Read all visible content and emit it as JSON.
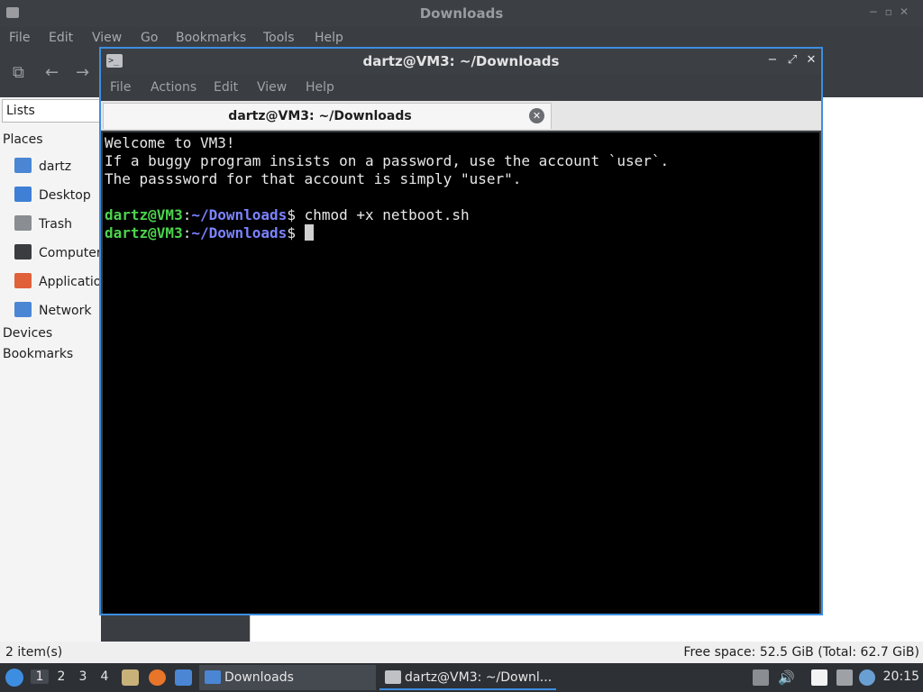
{
  "file_manager": {
    "title": "Downloads",
    "menu": [
      "File",
      "Edit",
      "View",
      "Go",
      "Bookmarks",
      "Tools",
      "Help"
    ],
    "side_mode": "Lists",
    "places_header": "Places",
    "places": [
      {
        "label": "dartz",
        "icon": "home-folder-icon",
        "color": "#4a86d4"
      },
      {
        "label": "Desktop",
        "icon": "desktop-icon",
        "color": "#3f7fd6"
      },
      {
        "label": "Trash",
        "icon": "trash-icon",
        "color": "#8a8d91"
      },
      {
        "label": "Computer",
        "icon": "computer-icon",
        "color": "#3a3c40"
      },
      {
        "label": "Applications",
        "icon": "applications-icon",
        "color": "#e0603a"
      },
      {
        "label": "Network",
        "icon": "network-icon",
        "color": "#4a86d4"
      }
    ],
    "devices_header": "Devices",
    "bookmarks_header": "Bookmarks",
    "status_left": "2 item(s)",
    "status_right": "Free space: 52.5 GiB (Total: 62.7 GiB)"
  },
  "terminal": {
    "title": "dartz@VM3: ~/Downloads",
    "menu": [
      "File",
      "Actions",
      "Edit",
      "View",
      "Help"
    ],
    "tab_label": "dartz@VM3: ~/Downloads",
    "lines": [
      "Welcome to VM3!",
      "If a buggy program insists on a password, use the account `user`.",
      "The passsword for that account is simply \"user\"."
    ],
    "prompt_user": "dartz@VM3",
    "prompt_sep": ":",
    "prompt_path": "~/Downloads",
    "prompt_end": "$ ",
    "command_1": "chmod +x netboot.sh",
    "command_2": ""
  },
  "taskbar": {
    "workspaces": [
      "1",
      "2",
      "3",
      "4"
    ],
    "active_workspace": "1",
    "tasks": [
      {
        "label": "Downloads",
        "icon": "folder-icon"
      },
      {
        "label": "dartz@VM3: ~/Downl...",
        "icon": "terminal-icon"
      }
    ],
    "clock": "20:15",
    "colors": {
      "accent": "#3d8ee0",
      "prompt_user": "#4cd44c",
      "prompt_path": "#7b83ff"
    }
  }
}
